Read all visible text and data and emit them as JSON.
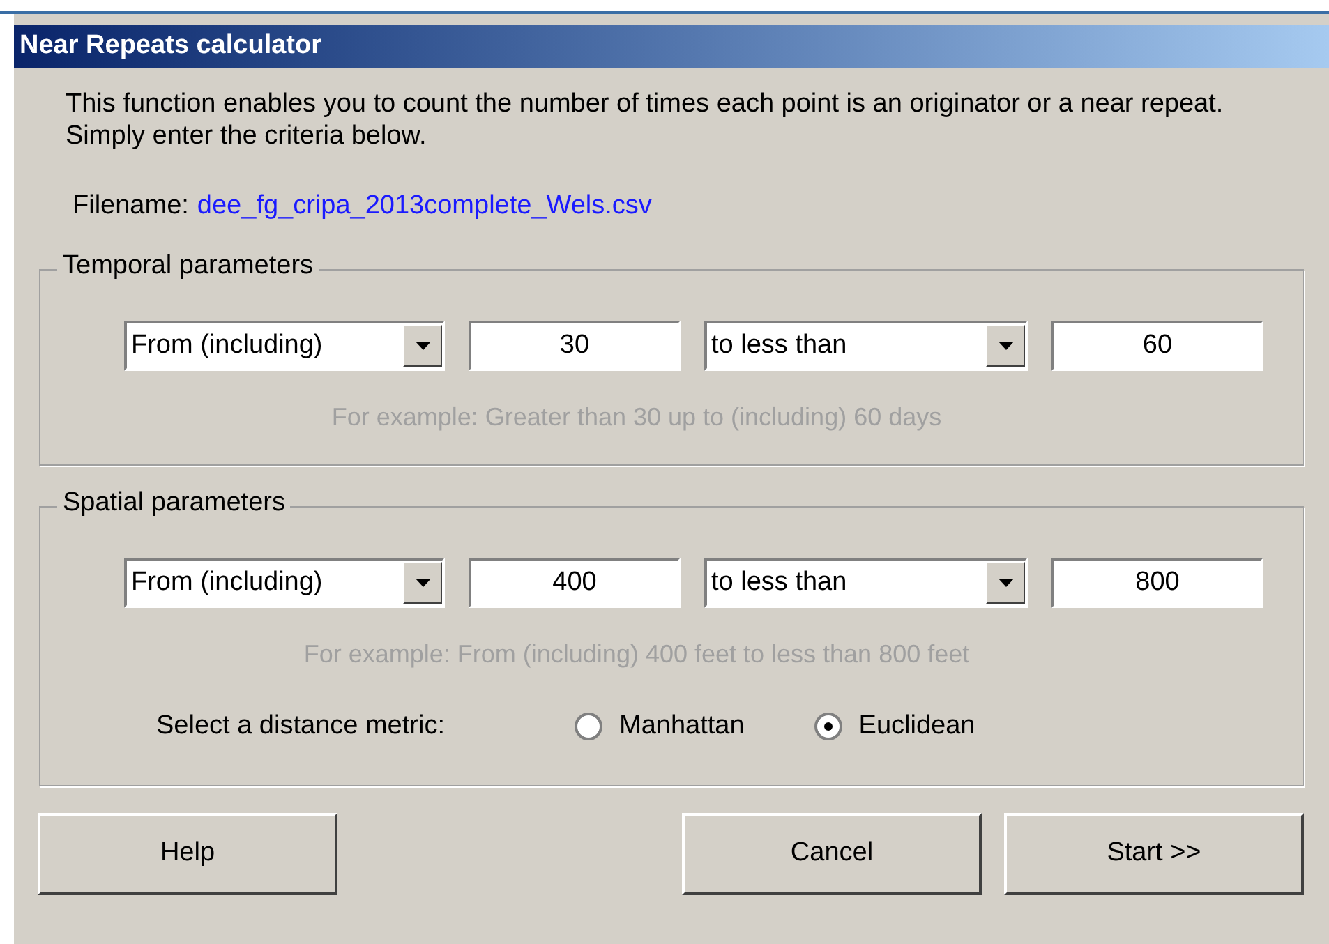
{
  "window": {
    "title": "Near Repeats calculator"
  },
  "intro": "This function enables you to count the number of times each point is an originator or a near repeat. Simply enter the criteria below.",
  "filename": {
    "label": "Filename:",
    "value": "dee_fg_cripa_2013complete_Wels.csv"
  },
  "groups": [
    {
      "title": "Temporal parameters",
      "from_select": "From (including)",
      "from_value": "30",
      "to_select": "to less than",
      "to_value": "60",
      "example": "For example: Greater than 30 up to (including) 60 days"
    },
    {
      "title": "Spatial parameters",
      "from_select": "From (including)",
      "from_value": "400",
      "to_select": "to less than",
      "to_value": "800",
      "example": "For example: From (including) 400 feet to less than 800 feet",
      "metric": {
        "label": "Select a distance metric:",
        "options": [
          {
            "label": "Manhattan",
            "selected": false
          },
          {
            "label": "Euclidean",
            "selected": true
          }
        ]
      }
    }
  ],
  "buttons": [
    {
      "label": "Help"
    },
    {
      "label": "Cancel"
    },
    {
      "label": "Start >>"
    }
  ]
}
